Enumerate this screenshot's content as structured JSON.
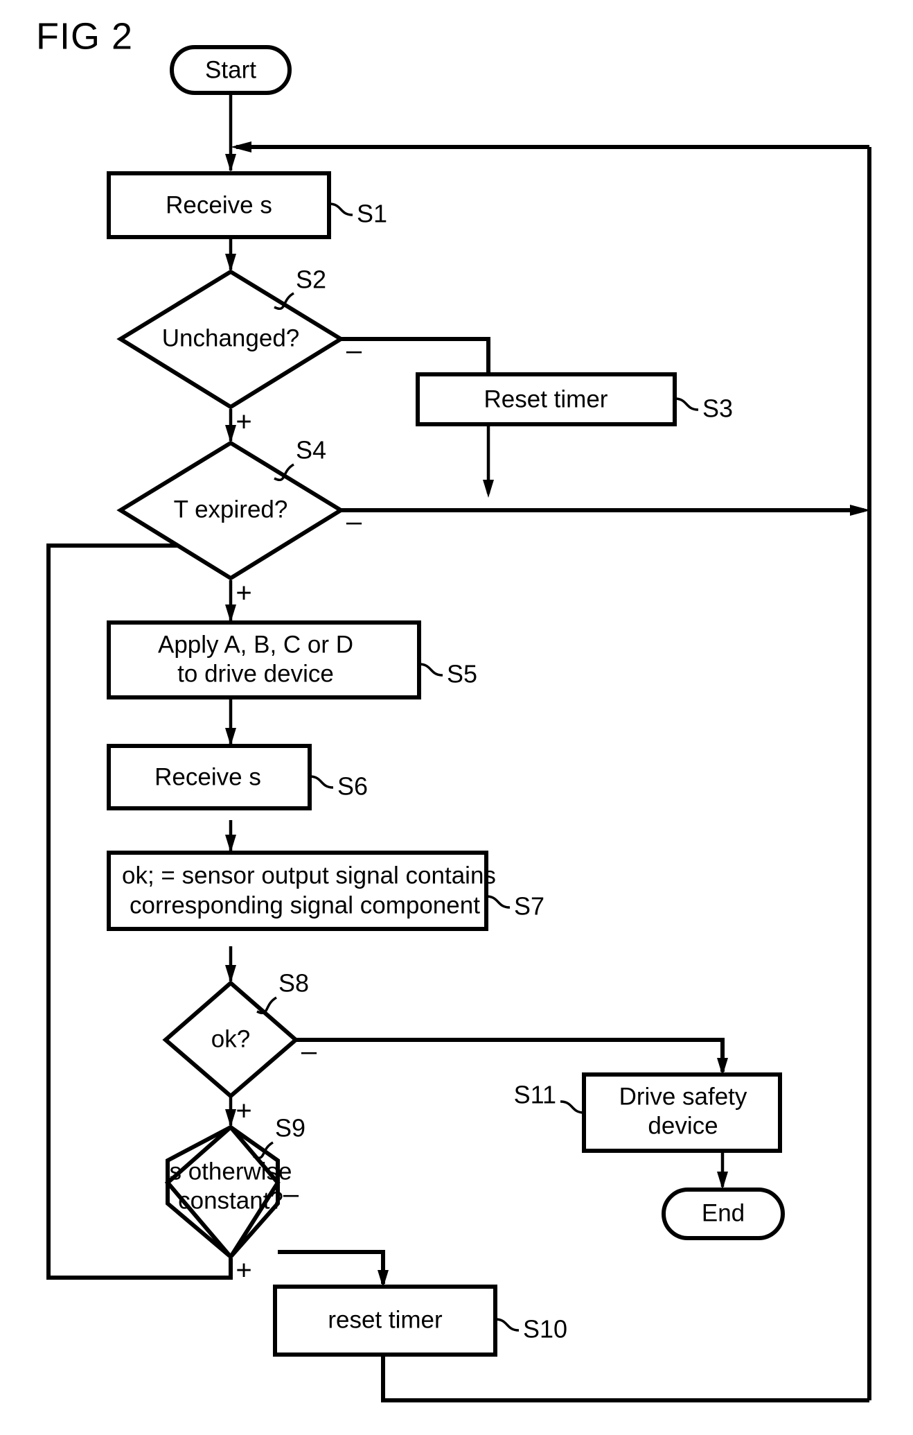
{
  "figure": {
    "title": "FIG 2",
    "type": "flowchart"
  },
  "nodes": {
    "start": {
      "label": "Start",
      "shape": "terminator"
    },
    "s1": {
      "label": "Receive s",
      "ref": "S1",
      "shape": "process"
    },
    "s2": {
      "label": "Unchanged?",
      "ref": "S2",
      "shape": "decision"
    },
    "s3": {
      "label": "Reset timer",
      "ref": "S3",
      "shape": "process"
    },
    "s4": {
      "label": "T expired?",
      "ref": "S4",
      "shape": "decision"
    },
    "s5": {
      "label_line1": "Apply A, B, C or D",
      "label_line2": "to drive device",
      "ref": "S5",
      "shape": "process"
    },
    "s6": {
      "label": "Receive s",
      "ref": "S6",
      "shape": "process"
    },
    "s7": {
      "label_line1": "ok; = sensor output signal contains",
      "label_line2": "corresponding signal component",
      "ref": "S7",
      "shape": "process"
    },
    "s8": {
      "label": "ok?",
      "ref": "S8",
      "shape": "decision"
    },
    "s9": {
      "label_line1": "s otherwise",
      "label_line2": "constant?",
      "ref": "S9",
      "shape": "decision"
    },
    "s10": {
      "label": "reset timer",
      "ref": "S10",
      "shape": "process"
    },
    "s11": {
      "label_line1": "Drive safety",
      "label_line2": "device",
      "ref": "S11",
      "shape": "process"
    },
    "end": {
      "label": "End",
      "shape": "terminator"
    }
  },
  "branch_labels": {
    "s2_minus": "–",
    "s2_plus": "+",
    "s4_minus": "–",
    "s4_plus": "+",
    "s8_minus": "–",
    "s8_plus": "+",
    "s9_minus": "–",
    "s9_plus": "+"
  },
  "colors": {
    "ink": "#000000",
    "paper": "#ffffff"
  }
}
